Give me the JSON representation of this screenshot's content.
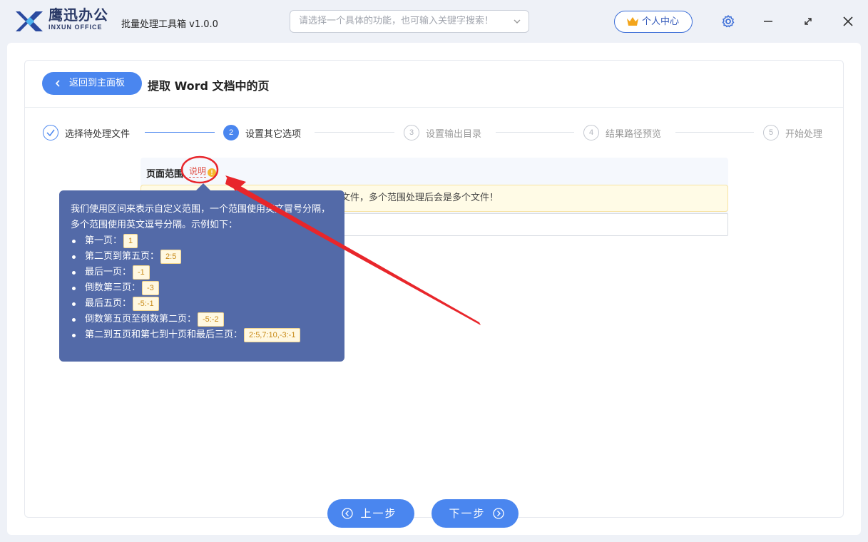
{
  "app": {
    "brand_cn": "鹰迅办公",
    "brand_en": "INXUN OFFICE",
    "app_name": "批量处理工具箱 v1.0.0"
  },
  "search": {
    "placeholder": "请选择一个具体的功能，也可输入关键字搜索！"
  },
  "header": {
    "user_center": "个人中心"
  },
  "page": {
    "back_label": "返回到主面板",
    "title": "提取 Word 文档中的页"
  },
  "steps": [
    {
      "num": "",
      "label": "选择待处理文件",
      "state": "done"
    },
    {
      "num": "2",
      "label": "设置其它选项",
      "state": "active"
    },
    {
      "num": "3",
      "label": "设置输出目录",
      "state": "pending"
    },
    {
      "num": "4",
      "label": "结果路径预览",
      "state": "pending"
    },
    {
      "num": "5",
      "label": "开始处理",
      "state": "pending"
    }
  ],
  "form": {
    "field_label": "页面范围",
    "help_link": "说明",
    "help_dot": "!",
    "notice_tail": "文件，多个范围处理后会是多个文件！"
  },
  "tooltip": {
    "intro": "我们使用区间来表示自定义范围，一个范围使用英文冒号分隔，多个范围使用英文逗号分隔。示例如下：",
    "items": [
      {
        "text": "第一页：",
        "code": "1"
      },
      {
        "text": "第二页到第五页：",
        "code": "2:5"
      },
      {
        "text": "最后一页：",
        "code": "-1"
      },
      {
        "text": "倒数第三页：",
        "code": "-3"
      },
      {
        "text": "最后五页：",
        "code": "-5:-1"
      },
      {
        "text": "倒数第五页至倒数第二页：",
        "code": "-5:-2"
      },
      {
        "text": "第二到五页和第七到十页和最后三页：",
        "code": "2:5,7:10,-3:-1"
      }
    ]
  },
  "nav": {
    "prev": "上一步",
    "next": "下一步"
  },
  "colors": {
    "accent": "#4a86ef",
    "tooltip_bg": "#536aa8",
    "annotation": "#e8262b"
  }
}
